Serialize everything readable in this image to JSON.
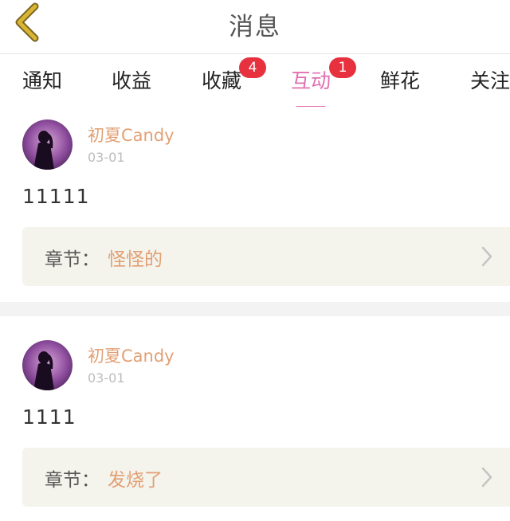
{
  "header": {
    "title": "消息",
    "back_icon": "chevron-left-icon",
    "back_icon_color": "#d9b533"
  },
  "tabs": [
    {
      "label": "通知",
      "badge": null,
      "active": false
    },
    {
      "label": "收益",
      "badge": null,
      "active": false
    },
    {
      "label": "收藏",
      "badge": "4",
      "active": false
    },
    {
      "label": "互动",
      "badge": "1",
      "active": true
    },
    {
      "label": "鲜花",
      "badge": null,
      "active": false
    },
    {
      "label": "关注",
      "badge": null,
      "active": false
    }
  ],
  "colors": {
    "accent_active_tab": "#e06fb0",
    "badge": "#e8313f",
    "username": "#e2a074",
    "chapter_card_bg": "#f4f3ec"
  },
  "messages": [
    {
      "username": "初夏Candy",
      "date": "03-01",
      "text": "11111",
      "chapter_label": "章节：",
      "chapter_name": "怪怪的"
    },
    {
      "username": "初夏Candy",
      "date": "03-01",
      "text": "1111",
      "chapter_label": "章节：",
      "chapter_name": "发烧了"
    }
  ]
}
